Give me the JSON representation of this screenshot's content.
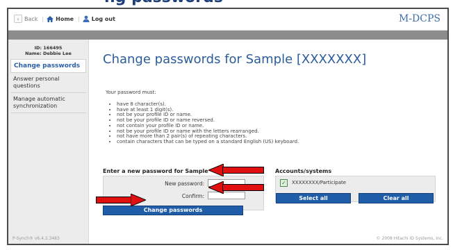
{
  "header_title": "ng passwords",
  "nav": {
    "back": "Back",
    "home": "Home",
    "logout": "Log out"
  },
  "brand": "M-DCPS",
  "user": {
    "id_line": "ID: 166495",
    "name_line": "Name: Debbie Lee"
  },
  "sidebar": {
    "items": [
      {
        "label": "Change passwords",
        "active": true
      },
      {
        "label": "Answer personal questions",
        "active": false
      },
      {
        "label": "Manage automatic synchronization",
        "active": false
      }
    ]
  },
  "main": {
    "title": "Change passwords for Sample [XXXXXXX]",
    "rules_intro": "Your password must:",
    "rules": [
      "have 8 character(s).",
      "have at least 1 digit(s).",
      "not be your profile ID or name.",
      "not be your profile ID or name reversed.",
      "not contain your profile ID or name.",
      "not be your profile ID or name with the letters rearranged.",
      "not have more than 2 pair(s) of repeating characters.",
      "contain characters that can be typed on a standard English (US) keyboard."
    ]
  },
  "password_form": {
    "heading": "Enter a new password for Sample",
    "new_label": "New password:",
    "confirm_label": "Confirm:",
    "submit_label": "Change passwords"
  },
  "accounts": {
    "heading": "Accounts/systems",
    "items": [
      {
        "label": "XXXXXXXX/Participate",
        "checked": true
      }
    ],
    "select_all": "Select all",
    "clear_all": "Clear all"
  },
  "footer": {
    "version": "P-Synch® v6.4.2.3483",
    "copyright": "© 2008 Hitachi ID Systems, Inc."
  },
  "colors": {
    "accent": "#1f5da8",
    "arrow": "#e01010",
    "title": "#2c5d9a"
  }
}
